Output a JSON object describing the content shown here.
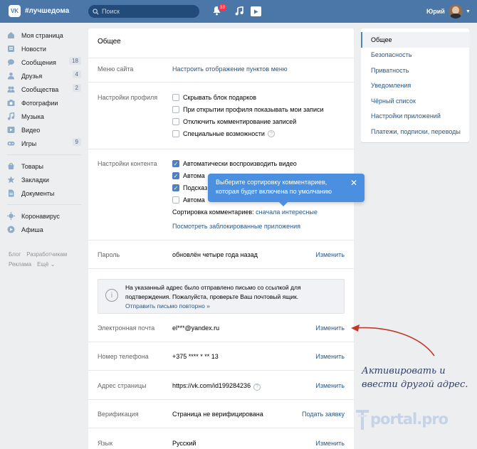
{
  "header": {
    "logo": "VK",
    "hashtag": "#лучшедома",
    "search_placeholder": "Поиск",
    "notif_count": "18",
    "user_name": "Юрий"
  },
  "leftnav": {
    "items": [
      {
        "label": "Моя страница",
        "icon": "home-icon",
        "count": ""
      },
      {
        "label": "Новости",
        "icon": "news-icon",
        "count": ""
      },
      {
        "label": "Сообщения",
        "icon": "messages-icon",
        "count": "18"
      },
      {
        "label": "Друзья",
        "icon": "friends-icon",
        "count": "4"
      },
      {
        "label": "Сообщества",
        "icon": "communities-icon",
        "count": "2"
      },
      {
        "label": "Фотографии",
        "icon": "photos-icon",
        "count": ""
      },
      {
        "label": "Музыка",
        "icon": "music-icon",
        "count": ""
      },
      {
        "label": "Видео",
        "icon": "video-icon",
        "count": ""
      },
      {
        "label": "Игры",
        "icon": "games-icon",
        "count": "9"
      }
    ],
    "items2": [
      {
        "label": "Товары",
        "icon": "goods-icon"
      },
      {
        "label": "Закладки",
        "icon": "bookmarks-icon"
      },
      {
        "label": "Документы",
        "icon": "documents-icon"
      }
    ],
    "items3": [
      {
        "label": "Коронавирус",
        "icon": "virus-icon"
      },
      {
        "label": "Афиша",
        "icon": "afisha-icon"
      }
    ],
    "footer": {
      "blog": "Блог",
      "dev": "Разработчикам",
      "ads": "Реклама",
      "more": "Ещё ⌄"
    }
  },
  "main": {
    "title": "Общее",
    "site_menu": {
      "label": "Меню сайта",
      "link": "Настроить отображение пунктов меню"
    },
    "profile": {
      "label": "Настройки профиля",
      "options": [
        "Скрывать блок подарков",
        "При открытии профиля показывать мои записи",
        "Отключить комментирование записей",
        "Специальные возможности"
      ]
    },
    "content": {
      "label": "Настройки контента",
      "opt1": "Автоматически воспроизводить видео",
      "opt2": "Автома",
      "opt3": "Подсказ",
      "opt4": "Автома",
      "sort_label": "Сортировка комментариев:",
      "sort_value": "сначала интересные",
      "blocked_apps": "Посмотреть заблокированные приложения"
    },
    "password": {
      "label": "Пароль",
      "value": "обновлён четыре года назад",
      "action": "Изменить"
    },
    "notice": {
      "text": "На указанный адрес было отправлено письмо со ссылкой для подтверждения. Пожалуйста, проверьте Ваш почтовый ящик.",
      "resend": "Отправить письмо повторно »"
    },
    "email": {
      "label": "Электронная почта",
      "value": "el***@yandex.ru",
      "action": "Изменить"
    },
    "phone": {
      "label": "Номер телефона",
      "value": "+375 **** * ** 13",
      "action": "Изменить"
    },
    "address": {
      "label": "Адрес страницы",
      "value": "https://vk.com/id199284236",
      "action": "Изменить"
    },
    "verification": {
      "label": "Верификация",
      "value": "Страница не верифицирована",
      "action": "Подать заявку"
    },
    "language": {
      "label": "Язык",
      "value": "Русский",
      "action": "Изменить"
    }
  },
  "tooltip": {
    "text": "Выберите сортировку комментариев, которая будет включена по умолчанию"
  },
  "rightmenu": {
    "items": [
      "Общее",
      "Безопасность",
      "Приватность",
      "Уведомления",
      "Чёрный список",
      "Настройки приложений",
      "Платежи, подписки, переводы"
    ]
  },
  "annotation": {
    "line1": "Активировать и",
    "line2": "ввести другой адрес."
  },
  "watermark": {
    "text": "portal.pro"
  },
  "colors": {
    "brand": "#4a76a8",
    "link": "#2a5885",
    "tooltip": "#4a8fe0",
    "arrow": "#c0392b"
  }
}
